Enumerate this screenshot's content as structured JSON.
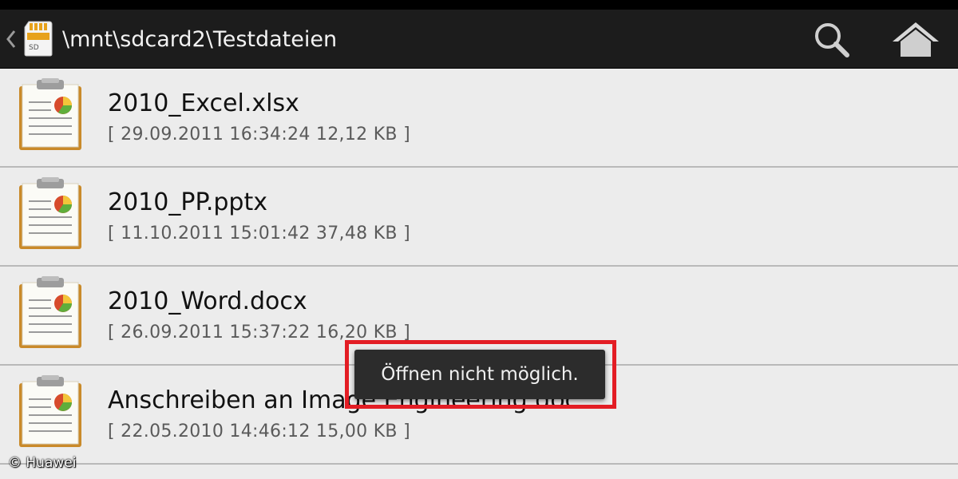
{
  "action_bar": {
    "path": "\\mnt\\sdcard2\\Testdateien",
    "sd_label": "SD",
    "icons": {
      "up": "chevron-left-icon",
      "storage": "sd-card-icon",
      "search": "search-icon",
      "home": "home-icon"
    }
  },
  "files": [
    {
      "name": "2010_Excel.xlsx",
      "meta": "[ 29.09.2011 16:34:24 12,12 KB ]",
      "icon": "document-chart-icon"
    },
    {
      "name": "2010_PP.pptx",
      "meta": "[ 11.10.2011 15:01:42 37,48 KB ]",
      "icon": "document-chart-icon"
    },
    {
      "name": "2010_Word.docx",
      "meta": "[ 26.09.2011 15:37:22 16,20 KB ]",
      "icon": "document-chart-icon"
    },
    {
      "name": "Anschreiben an Image Engineering.doc",
      "meta": "[ 22.05.2010 14:46:12 15,00 KB ]",
      "icon": "document-chart-icon"
    }
  ],
  "toast": {
    "message": "Öffnen nicht möglich."
  },
  "credit": "© Huawei",
  "colors": {
    "action_bar": "#1c1c1c",
    "list_background": "#ececec",
    "highlight": "#e31d24",
    "toast": "#2c2c2c"
  }
}
